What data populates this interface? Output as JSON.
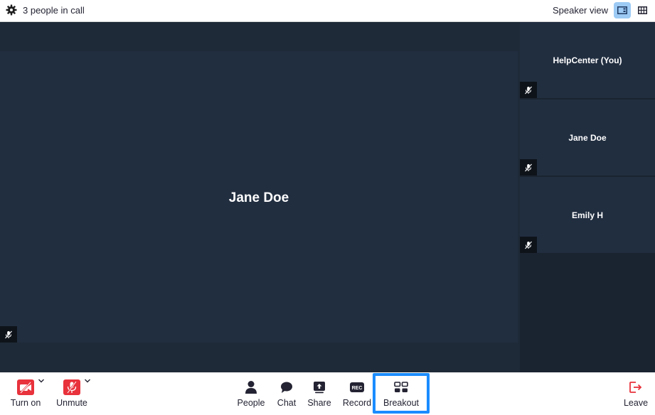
{
  "topbar": {
    "participant_count": "3 people in call",
    "view_label": "Speaker view"
  },
  "main_speaker": {
    "name": "Jane Doe"
  },
  "participants": [
    {
      "name": "HelpCenter (You)"
    },
    {
      "name": "Jane Doe"
    },
    {
      "name": "Emily H"
    }
  ],
  "toolbar": {
    "video_label": "Turn on",
    "audio_label": "Unmute",
    "people_label": "People",
    "chat_label": "Chat",
    "share_label": "Share",
    "record_label": "Record",
    "record_badge": "REC",
    "breakout_label": "Breakout",
    "leave_label": "Leave"
  },
  "colors": {
    "accent": "#1a8cff",
    "danger": "#e8323c",
    "tile": "#212e40",
    "stage": "#1f2a38"
  }
}
